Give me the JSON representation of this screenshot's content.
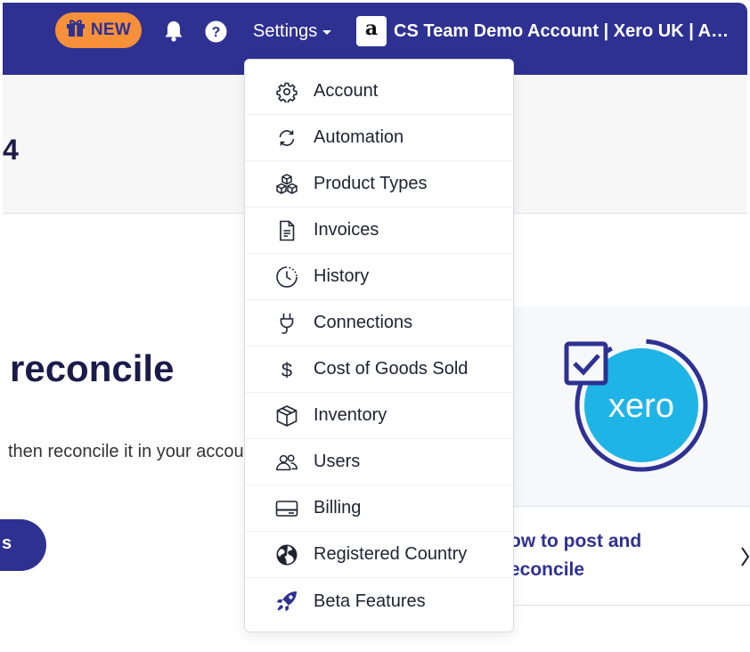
{
  "topbar": {
    "new_badge": "NEW",
    "settings_label": "Settings",
    "account_logo_letter": "a",
    "account_name": "CS Team Demo Account | Xero UK | Amazon UK"
  },
  "background": {
    "band_number": "4",
    "heading": "reconcile",
    "description": "then reconcile it in your accounting software",
    "pill_text": "s",
    "card_title_lines": [
      "ow to post and",
      "econcile"
    ],
    "xero_logo_text": "xero"
  },
  "settings_menu": {
    "items": [
      {
        "label": "Account",
        "icon": "gear-icon"
      },
      {
        "label": "Automation",
        "icon": "sync-icon"
      },
      {
        "label": "Product Types",
        "icon": "cubes-icon"
      },
      {
        "label": "Invoices",
        "icon": "document-icon"
      },
      {
        "label": "History",
        "icon": "clock-history-icon"
      },
      {
        "label": "Connections",
        "icon": "plug-icon"
      },
      {
        "label": "Cost of Goods Sold",
        "icon": "dollar-icon"
      },
      {
        "label": "Inventory",
        "icon": "box-icon"
      },
      {
        "label": "Users",
        "icon": "users-icon"
      },
      {
        "label": "Billing",
        "icon": "credit-card-icon"
      },
      {
        "label": "Registered Country",
        "icon": "globe-icon"
      },
      {
        "label": "Beta Features",
        "icon": "rocket-icon"
      }
    ]
  },
  "colors": {
    "brand": "#2e3192",
    "new_badge": "#f7903a",
    "xero": "#1fb4e6"
  }
}
